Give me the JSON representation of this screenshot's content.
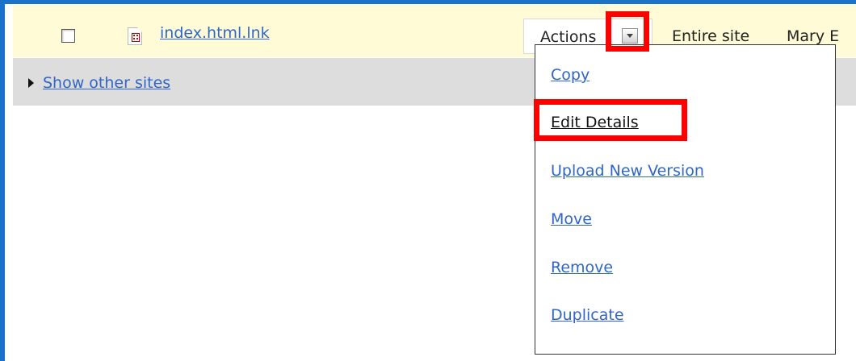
{
  "file_row": {
    "file_name": "index.html.lnk",
    "actions_label": "Actions",
    "site_column": "Entire site",
    "owner_column": "Mary E"
  },
  "other_sites": {
    "label": "Show other sites"
  },
  "actions_menu": {
    "items": [
      "Copy",
      "Edit Details",
      "Upload New Version",
      "Move",
      "Remove",
      "Duplicate"
    ],
    "highlighted": "Edit Details"
  },
  "colors": {
    "frame": "#1a73c9",
    "row_highlight": "#fffbd6",
    "link": "#2f66c8",
    "callout": "#ff0000",
    "secondary_row": "#dddddd"
  },
  "icons": {
    "file": "lnk-file-icon",
    "dropdown": "chevron-down-icon",
    "expand": "triangle-right-icon"
  }
}
